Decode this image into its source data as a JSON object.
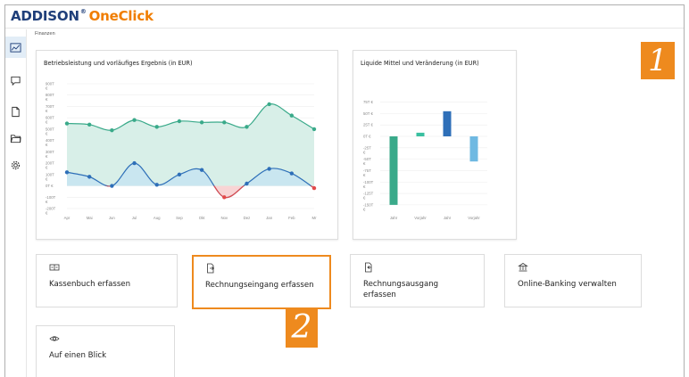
{
  "app": {
    "brand_left": "ADDISON",
    "brand_tm": "®",
    "brand_right": "OneClick"
  },
  "breadcrumb": "Finanzen",
  "sidebar": {
    "items": [
      {
        "name": "dashboard",
        "icon": "chart-line-icon",
        "active": true
      },
      {
        "name": "messages",
        "icon": "chat-bubble-icon",
        "active": false
      },
      {
        "name": "documents",
        "icon": "document-icon",
        "active": false
      },
      {
        "name": "folders",
        "icon": "folder-icon",
        "active": false
      },
      {
        "name": "settings",
        "icon": "gear-icon",
        "active": false
      }
    ]
  },
  "badges": {
    "one": "1",
    "two": "2"
  },
  "colors": {
    "accent": "#ee8a1e",
    "green": "#3aaa8a",
    "blue": "#2e6fb8",
    "red": "#e24a4a",
    "lightblue": "#6fb9e2",
    "brand_blue": "#1f3f7a",
    "brand_orange": "#f07d00"
  },
  "chart_data": [
    {
      "type": "line",
      "title": "Betriebsleistung und vorläufiges Ergebnis (in EUR)",
      "categories": [
        "Apr",
        "Mai",
        "Jun",
        "Jul",
        "Aug",
        "Sep",
        "Okt",
        "Nov",
        "Dez",
        "Jan",
        "Feb",
        "Mr"
      ],
      "y_ticks": [
        [
          "900T",
          "€"
        ],
        [
          "800T",
          "€"
        ],
        [
          "700T",
          "€"
        ],
        [
          "600T",
          "€"
        ],
        [
          "500T",
          "€"
        ],
        [
          "400T",
          "€"
        ],
        [
          "300T",
          "€"
        ],
        [
          "200T",
          "€"
        ],
        [
          "100T",
          "€"
        ],
        [
          "0T €"
        ],
        [
          "-100T",
          "€"
        ],
        [
          "-200T",
          "€"
        ]
      ],
      "ylim": [
        -200,
        900
      ],
      "series": [
        {
          "values": [
            550,
            540,
            490,
            580,
            520,
            570,
            560,
            560,
            520,
            720,
            620,
            500
          ],
          "color": "#3aaa8a",
          "area": true
        },
        {
          "values": [
            120,
            80,
            0,
            200,
            10,
            100,
            140,
            -100,
            20,
            150,
            110,
            -20
          ],
          "color": "#2e6fb8",
          "area": true,
          "negative_color": "#e24a4a"
        }
      ],
      "grid": true
    },
    {
      "type": "bar",
      "title": "Liquide Mittel und Veränderung (in EUR)",
      "categories": [
        "Jahr",
        "Vorjahr",
        "Jahr",
        "Vorjahr"
      ],
      "values": [
        -150,
        8,
        55,
        -55
      ],
      "colors": [
        "#3aaa8a",
        "#3ac0a0",
        "#2e6fb8",
        "#6fb9e2"
      ],
      "y_ticks": [
        [
          "75T €"
        ],
        [
          "50T €"
        ],
        [
          "25T €"
        ],
        [
          "0T €"
        ],
        [
          "-25T",
          "€"
        ],
        [
          "-50T",
          "€"
        ],
        [
          "-75T",
          "€"
        ],
        [
          "-100T",
          "€"
        ],
        [
          "-125T",
          "€"
        ],
        [
          "-150T",
          "€"
        ]
      ],
      "ylim": [
        -160,
        80
      ],
      "grid": true
    }
  ],
  "actions": [
    {
      "label": "Kassenbuch erfassen",
      "icon": "cash-register-icon"
    },
    {
      "label": "Rechnungseingang erfassen",
      "icon": "invoice-in-icon"
    },
    {
      "label": "Rechnungsausgang",
      "label2": "erfassen",
      "icon": "invoice-out-icon"
    },
    {
      "label": "Online-Banking verwalten",
      "icon": "bank-icon"
    },
    {
      "label": "Auf einen Blick",
      "icon": "eye-icon"
    }
  ]
}
